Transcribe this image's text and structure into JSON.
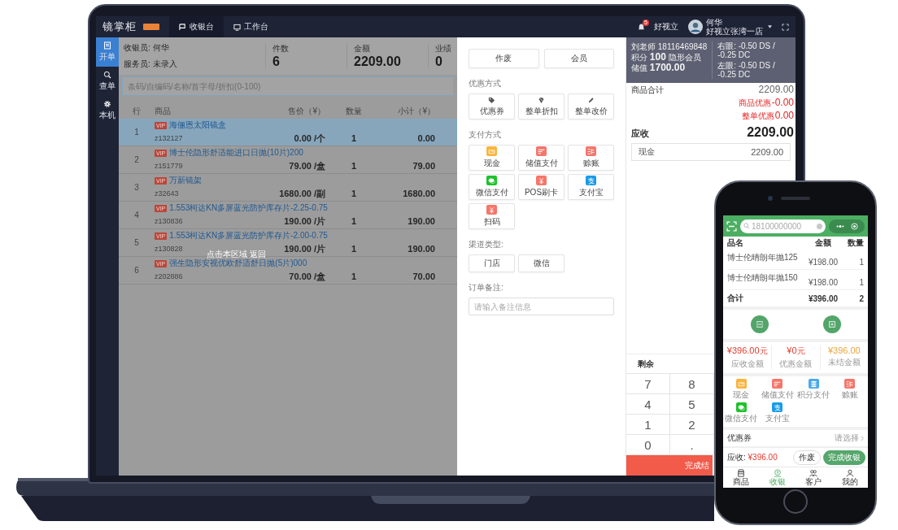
{
  "laptop": {
    "top_bar": {
      "logo": "镜掌柜",
      "tabs": [
        {
          "label": "收银台",
          "selected": true
        },
        {
          "label": "工作台",
          "selected": false
        }
      ],
      "notification_count": "5",
      "shop": "好视立",
      "user": {
        "name": "何华",
        "store": "好视立张湾一店"
      }
    },
    "sidebar": [
      {
        "label": "开单",
        "selected": true
      },
      {
        "label": "查单",
        "selected": false
      },
      {
        "label": "本机",
        "selected": false
      }
    ],
    "staff": [
      {
        "label": "收银员:",
        "value": "何华"
      },
      {
        "label": "服务员:",
        "value": "未录入"
      }
    ],
    "stats": [
      {
        "label": "件数",
        "value": "6"
      },
      {
        "label": "金额",
        "value": "2209.00"
      },
      {
        "label": "业绩",
        "value": "0"
      }
    ],
    "search": {
      "placeholder": "条码/自编码/名称/首字母/折扣(0-100)"
    },
    "table": {
      "columns": [
        "行",
        "商品",
        "售价（¥）",
        "数量",
        "小计（¥）"
      ],
      "rows": [
        {
          "line": "1",
          "tag": "VIP",
          "name": "海俪恩太阳镜盒",
          "code": "z132127",
          "price": "0.00 /个",
          "qty": "1",
          "subtotal": "0.00",
          "selected": true
        },
        {
          "line": "2",
          "tag": "VIP",
          "name": "博士伦隐形舒适能进口日抛(10片)200",
          "code": "z151779",
          "price": "79.00 /盒",
          "qty": "1",
          "subtotal": "79.00",
          "selected": false
        },
        {
          "line": "3",
          "tag": "VIP",
          "name": "万新镜架",
          "code": "z32643",
          "price": "1680.00 /副",
          "qty": "1",
          "subtotal": "1680.00",
          "selected": false
        },
        {
          "line": "4",
          "tag": "VIP",
          "name": "1.553柯达KN多屏蓝光防护库存片-2.25-0.75",
          "code": "z130836",
          "price": "190.00 /片",
          "qty": "1",
          "subtotal": "190.00",
          "selected": false
        },
        {
          "line": "5",
          "tag": "VIP",
          "name": "1.553柯达KN多屏蓝光防护库存片-2.00-0.75",
          "code": "z130828",
          "price": "190.00 /片",
          "qty": "1",
          "subtotal": "190.00",
          "selected": false
        },
        {
          "line": "6",
          "tag": "VIP",
          "name": "强生隐形安视优欧舒适舒日抛(5片)000",
          "code": "z202886",
          "price": "70.00 /盒",
          "qty": "1",
          "subtotal": "70.00",
          "selected": false
        }
      ]
    },
    "overlay_hint": "点击本区域 返回",
    "actions": [
      "作废",
      "会员"
    ],
    "discount": {
      "title": "优惠方式",
      "options": [
        "优惠券",
        "整单折扣",
        "整单改价"
      ]
    },
    "payment": {
      "title": "支付方式",
      "methods": [
        {
          "label": "现金",
          "kind": "cash",
          "color": "#f9b53f"
        },
        {
          "label": "储值支付",
          "kind": "stored",
          "color": "#f4766a"
        },
        {
          "label": "赊账",
          "kind": "credit",
          "color": "#f4766a"
        },
        {
          "label": "微信支付",
          "kind": "wechat",
          "color": "#1dc22a"
        },
        {
          "label": "POS刷卡",
          "kind": "pos",
          "color": "#f4766a"
        },
        {
          "label": "支付宝",
          "kind": "alipay",
          "color": "#1a9be8"
        },
        {
          "label": "扫码",
          "kind": "scan",
          "color": "#f4766a"
        }
      ]
    },
    "channel": {
      "title": "渠道类型:",
      "options": [
        "门店",
        "微信"
      ]
    },
    "note": {
      "title": "订单备注:",
      "placeholder": "请输入备注信息"
    },
    "member": {
      "name_phone": "刘老师 18116469848",
      "points_label": "积分",
      "points": "100",
      "level": "隐形会员",
      "balance_label": "储值",
      "balance": "1700.00",
      "prescriptions": [
        "右眼: -0.50 DS / -0.25 DC",
        "左眼: -0.50 DS / -0.25 DC"
      ]
    },
    "summary": [
      {
        "label": "商品合计",
        "value": "2209.00",
        "kind": "total"
      },
      {
        "label": "商品优惠",
        "value": "-0.00",
        "kind": "discount"
      },
      {
        "label": "整单优惠",
        "value": "0.00",
        "kind": "discount"
      }
    ],
    "due": {
      "label": "应收",
      "value": "2209.00"
    },
    "paid": {
      "label": "现金",
      "value": "2209.00"
    },
    "remaining_label": "剩余",
    "keypad": [
      "7",
      "8",
      "4",
      "5",
      "1",
      "2",
      "0",
      "."
    ],
    "finish_button": "完成结"
  },
  "phone": {
    "search": {
      "placeholder": "18100000000"
    },
    "table": {
      "columns": [
        "品名",
        "金额",
        "数量"
      ],
      "rows": [
        {
          "name": "博士伦晴朗年抛125",
          "amount": "¥198.00",
          "qty": "1"
        },
        {
          "name": "博士伦晴朗年抛150",
          "amount": "¥198.00",
          "qty": "1"
        }
      ],
      "total": {
        "label": "合计",
        "amount": "¥396.00",
        "qty": "2"
      }
    },
    "amounts": [
      {
        "value": "¥396.00",
        "unit": "元",
        "label": "应收金额",
        "kind": "due"
      },
      {
        "value": "¥0",
        "unit": "元",
        "label": "优惠金额",
        "kind": "due"
      },
      {
        "value": "¥396.00",
        "label": "未结金额",
        "kind": "open"
      }
    ],
    "payments": [
      {
        "label": "现金",
        "kind": "cash",
        "color": "#f9b53f"
      },
      {
        "label": "储值支付",
        "kind": "stored",
        "color": "#f4766a"
      },
      {
        "label": "积分支付",
        "kind": "points",
        "color": "#4aa8ea"
      },
      {
        "label": "赊账",
        "kind": "credit",
        "color": "#f4766a"
      },
      {
        "label": "微信支付",
        "kind": "wechat",
        "color": "#1dc22a"
      },
      {
        "label": "支付宝",
        "kind": "alipay",
        "color": "#1a9be8"
      }
    ],
    "coupon": {
      "label": "优惠券",
      "hint": "请选择"
    },
    "due": {
      "label": "应收:",
      "value": "¥396.00"
    },
    "void_button": "作废",
    "finish_button": "完成收银",
    "tabs": [
      {
        "label": "商品",
        "selected": false
      },
      {
        "label": "收银",
        "selected": true
      },
      {
        "label": "客户",
        "selected": false
      },
      {
        "label": "我的",
        "selected": false
      }
    ]
  }
}
